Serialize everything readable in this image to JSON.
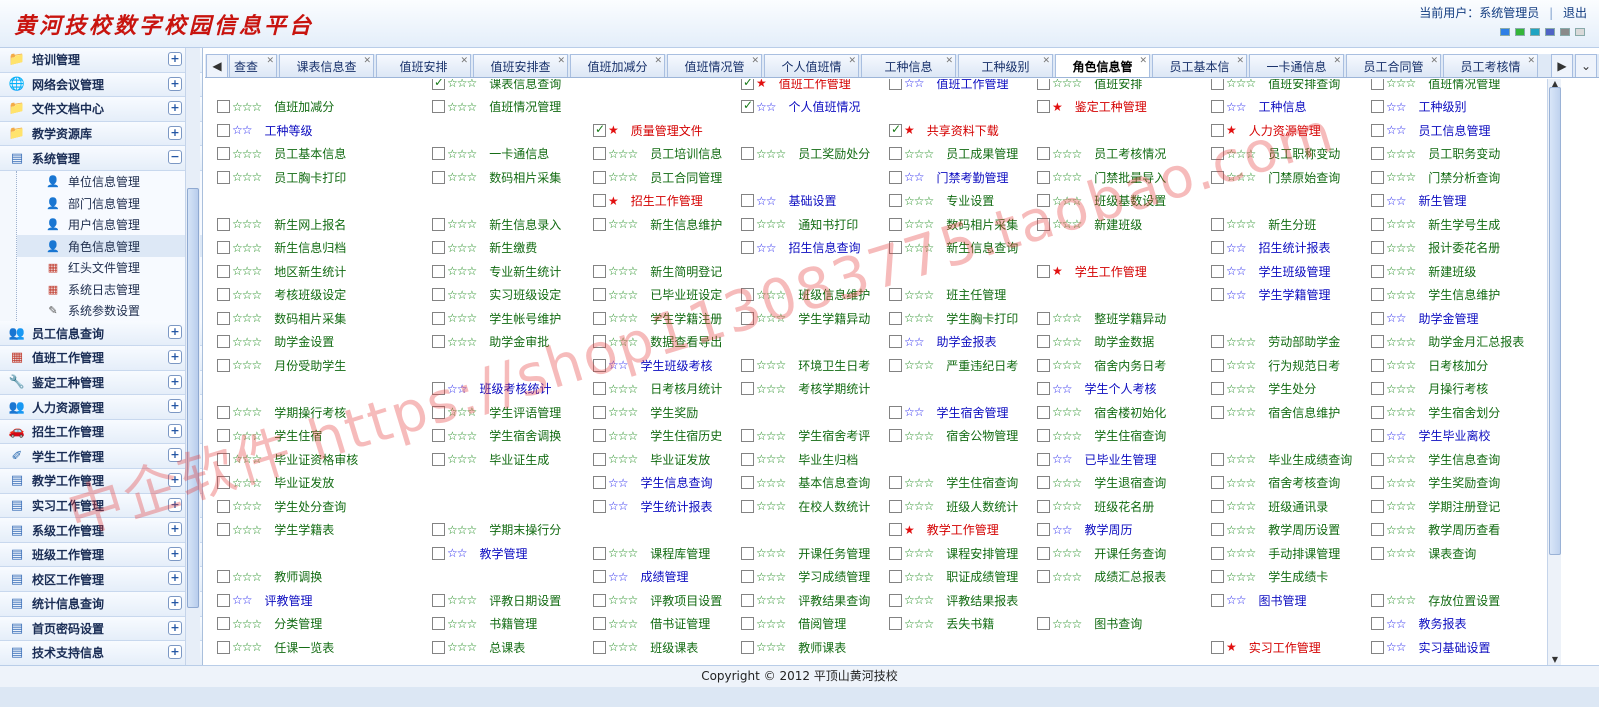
{
  "header": {
    "logo_text": "黄河技校数字校园信息平台",
    "current_user_label": "当前用户：系统管理员",
    "separator": "|",
    "logout_label": "退出",
    "swatch_colors": [
      "#2d7ee6",
      "#35b53a",
      "#1fa4c2",
      "#4f63c5",
      "#8a8a8a",
      "#d9d9d9"
    ]
  },
  "sidebar": {
    "items": [
      {
        "label": "培训管理",
        "icon": "folder-icon",
        "state": "+"
      },
      {
        "label": "网络会议管理",
        "icon": "globe-icon",
        "state": "+"
      },
      {
        "label": "文件文档中心",
        "icon": "folder-icon",
        "state": "+"
      },
      {
        "label": "教学资源库",
        "icon": "folder-icon",
        "state": "+"
      },
      {
        "label": "系统管理",
        "icon": "window-icon",
        "state": "−"
      }
    ],
    "sub_items": [
      {
        "label": "单位信息管理",
        "icon": "user-icon"
      },
      {
        "label": "部门信息管理",
        "icon": "user-icon"
      },
      {
        "label": "用户信息管理",
        "icon": "user-icon"
      },
      {
        "label": "角色信息管理",
        "icon": "user-icon"
      },
      {
        "label": "红头文件管理",
        "icon": "document-icon"
      },
      {
        "label": "系统日志管理",
        "icon": "document-icon"
      },
      {
        "label": "系统参数设置",
        "icon": "edit-icon"
      }
    ],
    "items_after": [
      {
        "label": "员工信息查询",
        "icon": "people-icon",
        "state": "+"
      },
      {
        "label": "值班工作管理",
        "icon": "calendar-icon",
        "state": "+"
      },
      {
        "label": "鉴定工种管理",
        "icon": "tools-icon",
        "state": "+"
      },
      {
        "label": "人力资源管理",
        "icon": "people-icon",
        "state": "+"
      },
      {
        "label": "招生工作管理",
        "icon": "car-icon",
        "state": "+"
      },
      {
        "label": "学生工作管理",
        "icon": "pencil-icon",
        "state": "+"
      },
      {
        "label": "教学工作管理",
        "icon": "window-icon",
        "state": "+"
      },
      {
        "label": "实习工作管理",
        "icon": "window-icon",
        "state": "+"
      },
      {
        "label": "系级工作管理",
        "icon": "window-icon",
        "state": "+"
      },
      {
        "label": "班级工作管理",
        "icon": "window-icon",
        "state": "+"
      },
      {
        "label": "校区工作管理",
        "icon": "window-icon",
        "state": "+"
      },
      {
        "label": "统计信息查询",
        "icon": "window-icon",
        "state": "+"
      },
      {
        "label": "首页密码设置",
        "icon": "window-icon",
        "state": "+"
      },
      {
        "label": "技术支持信息",
        "icon": "window-icon",
        "state": "+"
      }
    ]
  },
  "tabs": [
    {
      "label": "查查",
      "active": false
    },
    {
      "label": "课表信息查",
      "active": false
    },
    {
      "label": "值班安排",
      "active": false
    },
    {
      "label": "值班安排查",
      "active": false
    },
    {
      "label": "值班加减分",
      "active": false
    },
    {
      "label": "值班情况管",
      "active": false
    },
    {
      "label": "个人值班情",
      "active": false
    },
    {
      "label": "工种信息",
      "active": false
    },
    {
      "label": "工种级别",
      "active": false
    },
    {
      "label": "角色信息管",
      "active": true
    },
    {
      "label": "员工基本信",
      "active": false
    },
    {
      "label": "一卡通信息",
      "active": false
    },
    {
      "label": "员工合同管",
      "active": false
    },
    {
      "label": "员工考核情",
      "active": false
    }
  ],
  "tab_nav": {
    "prev": "◀",
    "next": "▶",
    "menu": "⌄"
  },
  "permissions_rows": [
    [
      [
        "",
        "",
        false
      ],
      [
        "课表信息查询",
        3,
        true
      ],
      [
        "",
        "",
        false
      ],
      [
        "值班工作管理",
        1,
        true
      ],
      [
        "值班工作管理",
        2,
        false
      ],
      [
        "值班安排",
        3,
        false
      ],
      [
        "值班安排查询",
        3,
        false
      ],
      [
        "值班情况管理",
        3,
        false
      ]
    ],
    [
      [
        "值班加减分",
        3,
        false
      ],
      [
        "值班情况管理",
        3,
        false
      ],
      [
        "",
        "",
        false
      ],
      [
        "个人值班情况",
        2,
        true
      ],
      [
        "",
        "",
        false
      ],
      [
        "鉴定工种管理",
        1,
        false
      ],
      [
        "工种信息",
        2,
        false
      ],
      [
        "工种级别",
        2,
        false
      ]
    ],
    [
      [
        "工种等级",
        2,
        false
      ],
      [
        "",
        "",
        false
      ],
      [
        "质量管理文件",
        1,
        true
      ],
      [
        "",
        "",
        false
      ],
      [
        "共享资料下载",
        1,
        true
      ],
      [
        "",
        "",
        false
      ],
      [
        "人力资源管理",
        1,
        false
      ],
      [
        "员工信息管理",
        2,
        false
      ]
    ],
    [
      [
        "员工基本信息",
        3,
        false
      ],
      [
        "一卡通信息",
        3,
        false
      ],
      [
        "员工培训信息",
        3,
        false
      ],
      [
        "员工奖励处分",
        3,
        false
      ],
      [
        "员工成果管理",
        3,
        false
      ],
      [
        "员工考核情况",
        3,
        false
      ],
      [
        "员工职称变动",
        3,
        false
      ],
      [
        "员工职务变动",
        3,
        false
      ]
    ],
    [
      [
        "员工胸卡打印",
        3,
        false
      ],
      [
        "数码相片采集",
        3,
        false
      ],
      [
        "员工合同管理",
        3,
        false
      ],
      [
        "",
        "",
        false
      ],
      [
        "门禁考勤管理",
        2,
        false
      ],
      [
        "门禁批量导入",
        3,
        false
      ],
      [
        "门禁原始查询",
        3,
        false
      ],
      [
        "门禁分析查询",
        3,
        false
      ]
    ],
    [
      [
        "",
        "",
        false
      ],
      [
        "",
        "",
        false
      ],
      [
        "招生工作管理",
        1,
        false
      ],
      [
        "基础设置",
        2,
        false
      ],
      [
        "专业设置",
        3,
        false
      ],
      [
        "班级基数设置",
        3,
        false
      ],
      [
        "",
        "",
        false
      ],
      [
        "新生管理",
        2,
        false
      ]
    ],
    [
      [
        "新生网上报名",
        3,
        false
      ],
      [
        "新生信息录入",
        3,
        false
      ],
      [
        "新生信息维护",
        3,
        false
      ],
      [
        "通知书打印",
        3,
        false
      ],
      [
        "数码相片采集",
        3,
        false
      ],
      [
        "新建班级",
        3,
        false
      ],
      [
        "新生分班",
        3,
        false
      ],
      [
        "新生学号生成",
        3,
        false
      ]
    ],
    [
      [
        "新生信息归档",
        3,
        false
      ],
      [
        "新生缴费",
        3,
        false
      ],
      [
        "",
        "",
        false
      ],
      [
        "招生信息查询",
        2,
        false
      ],
      [
        "新生信息查询",
        3,
        false
      ],
      [
        "",
        "",
        false
      ],
      [
        "招生统计报表",
        2,
        false
      ],
      [
        "报计委花名册",
        3,
        false
      ]
    ],
    [
      [
        "地区新生统计",
        3,
        false
      ],
      [
        "专业新生统计",
        3,
        false
      ],
      [
        "新生简明登记",
        3,
        false
      ],
      [
        "",
        "",
        false
      ],
      [
        "",
        "",
        false
      ],
      [
        "学生工作管理",
        1,
        false
      ],
      [
        "学生班级管理",
        2,
        false
      ],
      [
        "新建班级",
        3,
        false
      ]
    ],
    [
      [
        "考核班级设定",
        3,
        false
      ],
      [
        "实习班级设定",
        3,
        false
      ],
      [
        "已毕业班设定",
        3,
        false
      ],
      [
        "班级信息维护",
        3,
        false
      ],
      [
        "班主任管理",
        3,
        false
      ],
      [
        "",
        "",
        false
      ],
      [
        "学生学籍管理",
        2,
        false
      ],
      [
        "学生信息维护",
        3,
        false
      ]
    ],
    [
      [
        "数码相片采集",
        3,
        false
      ],
      [
        "学生帐号维护",
        3,
        false
      ],
      [
        "学生学籍注册",
        3,
        false
      ],
      [
        "学生学籍异动",
        3,
        false
      ],
      [
        "学生胸卡打印",
        3,
        false
      ],
      [
        "整班学籍异动",
        3,
        false
      ],
      [
        "",
        "",
        false
      ],
      [
        "助学金管理",
        2,
        false
      ]
    ],
    [
      [
        "助学金设置",
        3,
        false
      ],
      [
        "助学金审批",
        3,
        false
      ],
      [
        "数据查看导出",
        3,
        false
      ],
      [
        "",
        "",
        false
      ],
      [
        "助学金报表",
        2,
        false
      ],
      [
        "助学金数据",
        3,
        false
      ],
      [
        "劳动部助学金",
        3,
        false
      ],
      [
        "助学金月汇总报表",
        3,
        false
      ]
    ],
    [
      [
        "月份受助学生",
        3,
        false
      ],
      [
        "",
        "",
        false
      ],
      [
        "学生班级考核",
        2,
        false
      ],
      [
        "环境卫生日考",
        3,
        false
      ],
      [
        "严重违纪日考",
        3,
        false
      ],
      [
        "宿舍内务日考",
        3,
        false
      ],
      [
        "行为规范日考",
        3,
        false
      ],
      [
        "日考核加分",
        3,
        false
      ]
    ],
    [
      [
        "",
        "",
        false
      ],
      [
        "班级考核统计",
        2,
        false
      ],
      [
        "日考核月统计",
        3,
        false
      ],
      [
        "考核学期统计",
        3,
        false
      ],
      [
        "",
        "",
        false
      ],
      [
        "学生个人考核",
        2,
        false
      ],
      [
        "学生处分",
        3,
        false
      ],
      [
        "月操行考核",
        3,
        false
      ]
    ],
    [
      [
        "学期操行考核",
        3,
        false
      ],
      [
        "学生评语管理",
        3,
        false
      ],
      [
        "学生奖励",
        3,
        false
      ],
      [
        "",
        "",
        false
      ],
      [
        "学生宿舍管理",
        2,
        false
      ],
      [
        "宿舍楼初始化",
        3,
        false
      ],
      [
        "宿舍信息维护",
        3,
        false
      ],
      [
        "学生宿舍划分",
        3,
        false
      ]
    ],
    [
      [
        "学生住宿",
        3,
        false
      ],
      [
        "学生宿舍调换",
        3,
        false
      ],
      [
        "学生住宿历史",
        3,
        false
      ],
      [
        "学生宿舍考评",
        3,
        false
      ],
      [
        "宿舍公物管理",
        3,
        false
      ],
      [
        "学生住宿查询",
        3,
        false
      ],
      [
        "",
        "",
        false
      ],
      [
        "学生毕业离校",
        2,
        false
      ]
    ],
    [
      [
        "毕业证资格审核",
        3,
        false
      ],
      [
        "毕业证生成",
        3,
        false
      ],
      [
        "毕业证发放",
        3,
        false
      ],
      [
        "毕业生归档",
        3,
        false
      ],
      [
        "",
        "",
        false
      ],
      [
        "已毕业生管理",
        2,
        false
      ],
      [
        "毕业生成绩查询",
        3,
        false
      ],
      [
        "学生信息查询",
        3,
        false
      ]
    ],
    [
      [
        "毕业证发放",
        3,
        false
      ],
      [
        "",
        "",
        false
      ],
      [
        "学生信息查询",
        2,
        false
      ],
      [
        "基本信息查询",
        3,
        false
      ],
      [
        "学生住宿查询",
        3,
        false
      ],
      [
        "学生退宿查询",
        3,
        false
      ],
      [
        "宿舍考核查询",
        3,
        false
      ],
      [
        "学生奖励查询",
        3,
        false
      ]
    ],
    [
      [
        "学生处分查询",
        3,
        false
      ],
      [
        "",
        "",
        false
      ],
      [
        "学生统计报表",
        2,
        false
      ],
      [
        "在校人数统计",
        3,
        false
      ],
      [
        "班级人数统计",
        3,
        false
      ],
      [
        "班级花名册",
        3,
        false
      ],
      [
        "班级通讯录",
        3,
        false
      ],
      [
        "学期注册登记",
        3,
        false
      ]
    ],
    [
      [
        "学生学籍表",
        3,
        false
      ],
      [
        "学期末操行分",
        3,
        false
      ],
      [
        "",
        "",
        false
      ],
      [
        "",
        "",
        false
      ],
      [
        "教学工作管理",
        1,
        false
      ],
      [
        "教学周历",
        2,
        false
      ],
      [
        "教学周历设置",
        3,
        false
      ],
      [
        "教学周历查看",
        3,
        false
      ]
    ],
    [
      [
        "",
        "",
        false
      ],
      [
        "教学管理",
        2,
        false
      ],
      [
        "课程库管理",
        3,
        false
      ],
      [
        "开课任务管理",
        3,
        false
      ],
      [
        "课程安排管理",
        3,
        false
      ],
      [
        "开课任务查询",
        3,
        false
      ],
      [
        "手动排课管理",
        3,
        false
      ],
      [
        "课表查询",
        3,
        false
      ]
    ],
    [
      [
        "教师调换",
        3,
        false
      ],
      [
        "",
        "",
        false
      ],
      [
        "成绩管理",
        2,
        false
      ],
      [
        "学习成绩管理",
        3,
        false
      ],
      [
        "职证成绩管理",
        3,
        false
      ],
      [
        "成绩汇总报表",
        3,
        false
      ],
      [
        "学生成绩卡",
        3,
        false
      ],
      [
        "",
        "",
        false
      ]
    ],
    [
      [
        "评教管理",
        2,
        false
      ],
      [
        "评教日期设置",
        3,
        false
      ],
      [
        "评教项目设置",
        3,
        false
      ],
      [
        "评教结果查询",
        3,
        false
      ],
      [
        "评教结果报表",
        3,
        false
      ],
      [
        "",
        "",
        false
      ],
      [
        "图书管理",
        2,
        false
      ],
      [
        "存放位置设置",
        3,
        false
      ]
    ],
    [
      [
        "分类管理",
        3,
        false
      ],
      [
        "书籍管理",
        3,
        false
      ],
      [
        "借书证管理",
        3,
        false
      ],
      [
        "借阅管理",
        3,
        false
      ],
      [
        "丢失书籍",
        3,
        false
      ],
      [
        "图书查询",
        3,
        false
      ],
      [
        "",
        "",
        false
      ],
      [
        "教务报表",
        2,
        false
      ]
    ],
    [
      [
        "任课一览表",
        3,
        false
      ],
      [
        "总课表",
        3,
        false
      ],
      [
        "班级课表",
        3,
        false
      ],
      [
        "教师课表",
        3,
        false
      ],
      [
        "",
        "",
        false
      ],
      [
        "",
        "",
        false
      ],
      [
        "实习工作管理",
        1,
        false
      ],
      [
        "实习基础设置",
        2,
        false
      ]
    ]
  ],
  "star_glyphs": {
    "1": "★",
    "2": "☆☆",
    "3": "☆☆☆"
  },
  "footer": {
    "copyright": "Copyright © 2012 平顶山黄河技校"
  },
  "watermark": {
    "text": "中企软件 https://shop113083775.taobao.com"
  }
}
